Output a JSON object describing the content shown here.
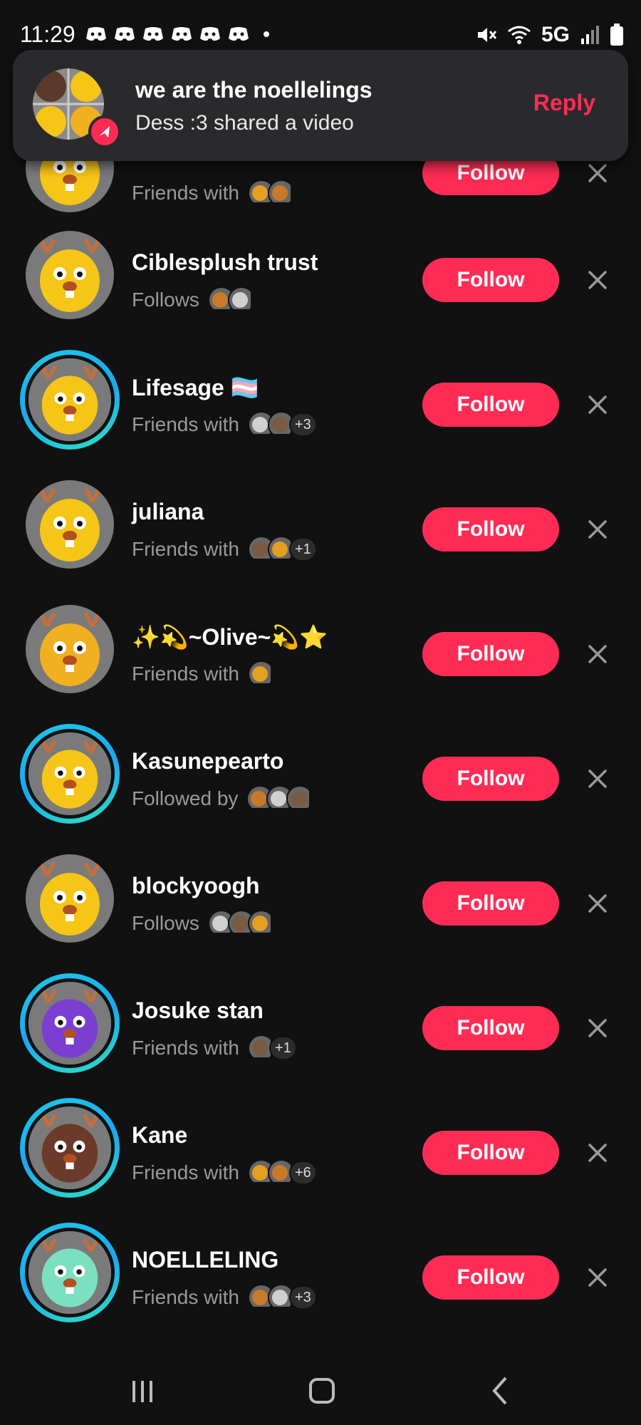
{
  "status_bar": {
    "time": "11:29",
    "network": "5G",
    "notification_icon": "discord-icon"
  },
  "notification": {
    "title": "we are the noellelings",
    "text": "Dess :3 shared a video",
    "reply_label": "Reply",
    "badge_icon": "send-arrow-icon"
  },
  "colors": {
    "accent": "#fe2c55",
    "background": "#111111",
    "story_ring": "#1ec8e8"
  },
  "suggestions": [
    {
      "name": "",
      "relation": "Friends with",
      "mutuals": 2,
      "more": "",
      "story": false,
      "follow_label": "Follow"
    },
    {
      "name": "Ciblesplush trust",
      "relation": "Follows",
      "mutuals": 2,
      "more": "",
      "story": false,
      "follow_label": "Follow"
    },
    {
      "name": "Lifesage 🏳️‍⚧️",
      "relation": "Friends with",
      "mutuals": 2,
      "more": "+3",
      "story": true,
      "follow_label": "Follow"
    },
    {
      "name": "juliana",
      "relation": "Friends with",
      "mutuals": 2,
      "more": "+1",
      "story": false,
      "follow_label": "Follow"
    },
    {
      "name": "✨💫~Olive~💫⭐",
      "relation": "Friends with",
      "mutuals": 1,
      "more": "",
      "story": false,
      "follow_label": "Follow"
    },
    {
      "name": "Kasunepearto",
      "relation": "Followed by",
      "mutuals": 3,
      "more": "",
      "story": true,
      "follow_label": "Follow"
    },
    {
      "name": "blockyoogh",
      "relation": "Follows",
      "mutuals": 3,
      "more": "",
      "story": false,
      "follow_label": "Follow"
    },
    {
      "name": "Josuke stan",
      "relation": "Friends with",
      "mutuals": 1,
      "more": "+1",
      "story": true,
      "follow_label": "Follow"
    },
    {
      "name": "Kane",
      "relation": "Friends with",
      "mutuals": 2,
      "more": "+6",
      "story": true,
      "follow_label": "Follow"
    },
    {
      "name": "NOELLELING",
      "relation": "Friends with",
      "mutuals": 2,
      "more": "+3",
      "story": true,
      "follow_label": "Follow"
    }
  ],
  "nav": {
    "recents_icon": "recents-icon",
    "home_icon": "home-icon",
    "back_icon": "back-icon"
  }
}
